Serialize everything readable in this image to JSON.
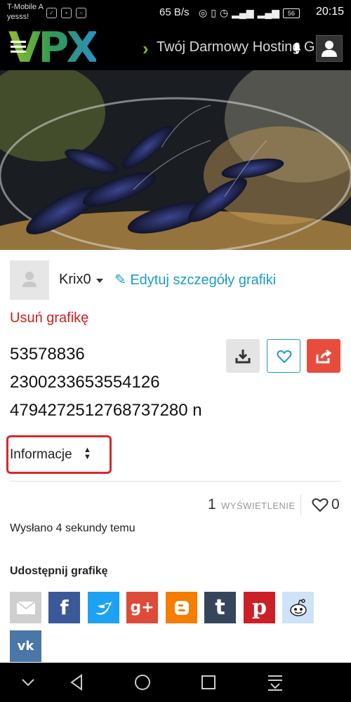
{
  "status_bar": {
    "carrier_line1": "T-Mobile A",
    "carrier_line2": "yesss!",
    "speed": "65 B/s",
    "battery": "56",
    "time": "20:15"
  },
  "header": {
    "logo": "VPX",
    "tagline": "Twój Darmowy Hosting Grafik"
  },
  "image_info": {
    "author": "Krix0",
    "edit_label": "Edytuj szczegóły grafiki",
    "delete_label": "Usuń grafikę",
    "title_lines": [
      "53578836",
      "2300233653554126",
      "4794272512768737280 n"
    ]
  },
  "info_select": {
    "selected": "Informacje"
  },
  "stats": {
    "views_count": "1",
    "views_label": "WYŚWIETLENIE",
    "likes_count": "0"
  },
  "posted_text": "Wysłano 4 sekundy temu",
  "share": {
    "heading": "Udostępnij grafikę",
    "buttons": [
      {
        "name": "email",
        "color": "#cfcfcf",
        "glyph": ""
      },
      {
        "name": "facebook",
        "color": "#3b5998",
        "glyph": "f"
      },
      {
        "name": "twitter",
        "color": "#1da1f2",
        "glyph": ""
      },
      {
        "name": "google-plus",
        "color": "#dd4b39",
        "glyph": "g+"
      },
      {
        "name": "blogger",
        "color": "#f57d00",
        "glyph": ""
      },
      {
        "name": "tumblr",
        "color": "#35465c",
        "glyph": "t"
      },
      {
        "name": "pinterest",
        "color": "#cb2027",
        "glyph": "p"
      },
      {
        "name": "reddit",
        "color": "#cee3f8",
        "glyph": ""
      },
      {
        "name": "vk",
        "color": "#4a76a8",
        "glyph": "vk"
      }
    ]
  }
}
